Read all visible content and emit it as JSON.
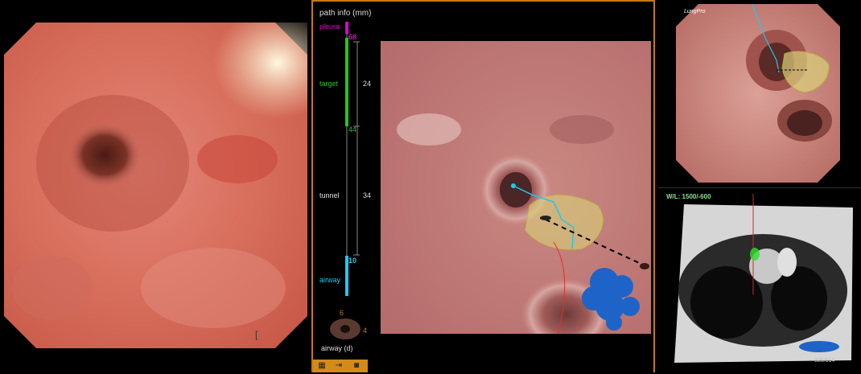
{
  "live_view": {
    "cursor_glyph": "["
  },
  "path_info": {
    "title": "path info (mm)",
    "pleura_label": "pleura",
    "pleura_value": "68",
    "target_label": "target",
    "target_segment_value": "24",
    "target_value": "44",
    "tunnel_label": "tunnel",
    "tunnel_segment_value": "34",
    "airway_value": "10",
    "airway_label": "airway",
    "airway_d_label": "airway (d)",
    "airway_d_outer": "6",
    "airway_d_inner": "4"
  },
  "toolbar": {
    "icons": [
      "grid-icon",
      "import-icon",
      "camera-icon"
    ]
  },
  "virtual_view": {
    "brand": "LungPro"
  },
  "ct_view": {
    "window_level": "W/L: 1500/-600",
    "slice": "326/514"
  },
  "colors": {
    "accent": "#d38a17",
    "pleura": "#e000d0",
    "target": "#1ec81e",
    "airway": "#1ec8f0",
    "lesion": "#d9d27a",
    "blue_blob": "#1e64c8"
  }
}
